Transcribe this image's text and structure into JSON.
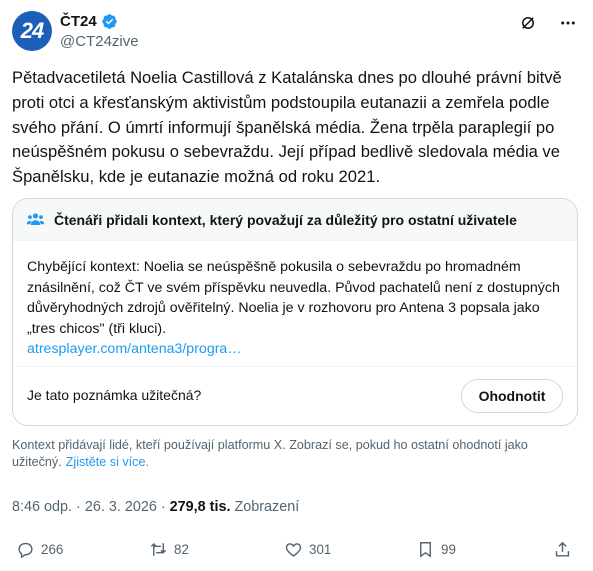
{
  "author": {
    "avatar_text": "24",
    "display_name": "ČT24",
    "handle": "@CT24zive",
    "colors": {
      "avatar_bg": "#1d5fb8",
      "verified": "#1d9bf0"
    }
  },
  "header_icons": [
    "grok-icon",
    "more-icon"
  ],
  "tweet": {
    "text": "Pětadvacetiletá Noelia Castillová z Katalánska dnes po dlouhé právní bitvě proti otci a křesťanským aktivistům podstoupila eutanazii a zemřela podle svého přání. O úmrtí informují španělská média. Žena trpěla paraplegií po neúspěšném pokusu o sebevraždu. Její případ bedlivě sledovala média ve Španělsku, kde je eutanazie možná od roku 2021."
  },
  "community_note": {
    "title": "Čtenáři přidali kontext, který považují za důležitý pro ostatní uživatele",
    "body": "Chybějící kontext: Noelia se neúspěšně pokusila o sebevraždu po hromadném znásilnění, což ČT ve svém příspěvku neuvedla. Původ pachatelů není z dostupných důvěryhodných zdrojů ověřitelný. Noelia je v rozhovoru pro Antena 3 popsala jako „tres chicos\" (tři kluci).",
    "link": "atresplayer.com/antena3/progra…",
    "question": "Je tato poznámka užitečná?",
    "rate_label": "Ohodnotit"
  },
  "footnote": {
    "text": "Kontext přidávají lidé, kteří používají platformu X. Zobrazí se, pokud ho ostatní ohodnotí jako užitečný.",
    "link": "Zjistěte si více."
  },
  "meta": {
    "time": "8:46 odp.",
    "separator": "·",
    "date": "26. 3. 2026",
    "views_count": "279,8 tis.",
    "views_label": "Zobrazení"
  },
  "actions": {
    "replies": "266",
    "reposts": "82",
    "likes": "301",
    "bookmarks": "99"
  }
}
